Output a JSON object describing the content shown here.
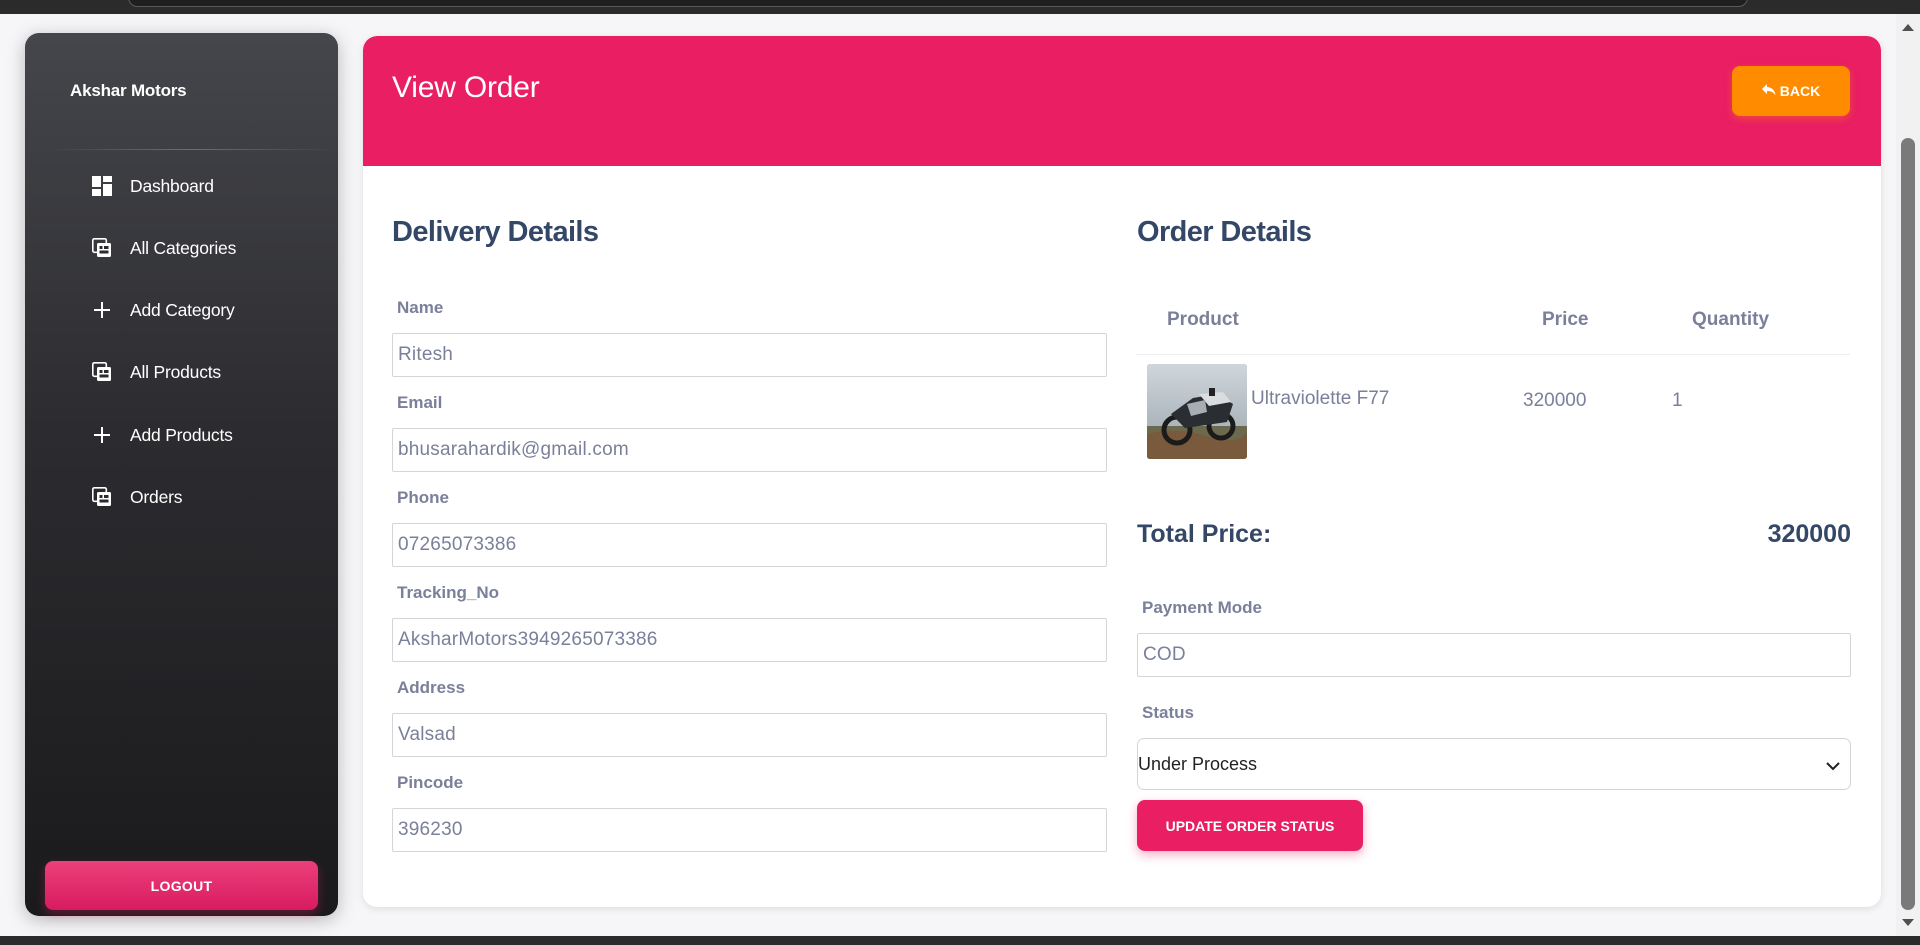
{
  "sidebar": {
    "brand": "Akshar Motors",
    "items": [
      {
        "label": "Dashboard",
        "icon": "dashboard-icon"
      },
      {
        "label": "All Categories",
        "icon": "collections-icon"
      },
      {
        "label": "Add Category",
        "icon": "plus-icon"
      },
      {
        "label": "All Products",
        "icon": "collections-icon"
      },
      {
        "label": "Add Products",
        "icon": "plus-icon"
      },
      {
        "label": "Orders",
        "icon": "collections-icon"
      }
    ],
    "logout_label": "LOGOUT"
  },
  "header": {
    "title": "View Order",
    "back_label": "BACK",
    "back_icon": "reply-icon"
  },
  "delivery": {
    "title": "Delivery Details",
    "fields": [
      {
        "label": "Name",
        "value": "Ritesh"
      },
      {
        "label": "Email",
        "value": "bhusarahardik@gmail.com"
      },
      {
        "label": "Phone",
        "value": "07265073386"
      },
      {
        "label": "Tracking_No",
        "value": "AksharMotors3949265073386"
      },
      {
        "label": "Address",
        "value": "Valsad"
      },
      {
        "label": "Pincode",
        "value": "396230"
      }
    ]
  },
  "order": {
    "title": "Order Details",
    "columns": [
      "Product",
      "Price",
      "Quantity"
    ],
    "rows": [
      {
        "product": "Ultraviolette F77",
        "price": "320000",
        "quantity": "1",
        "image": "motorcycle-image"
      }
    ],
    "total_label": "Total Price:",
    "total_value": "320000",
    "payment_mode_label": "Payment Mode",
    "payment_mode_value": "COD",
    "status_label": "Status",
    "status_value": "Under Process",
    "update_label": "UPDATE ORDER STATUS"
  },
  "colors": {
    "accent": "#e91e63",
    "back_button": "#ff8c00",
    "heading": "#344767",
    "muted_text": "#7b809a"
  }
}
